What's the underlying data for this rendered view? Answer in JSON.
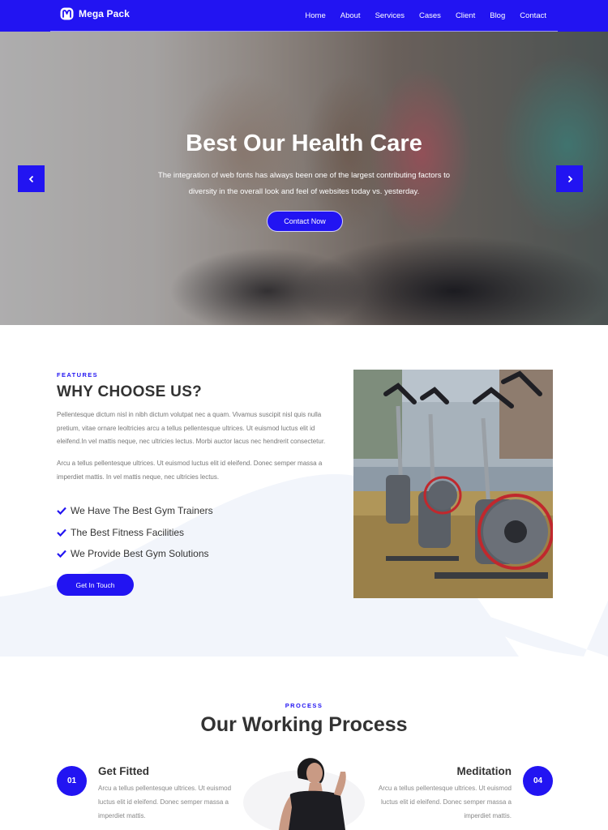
{
  "nav": {
    "brand": "Mega Pack",
    "items": [
      "Home",
      "About",
      "Services",
      "Cases",
      "Client",
      "Blog",
      "Contact"
    ]
  },
  "hero": {
    "title": "Best Our Health Care",
    "text": "The integration of web fonts has always been one of the largest contributing factors to diversity in the overall look and feel of websites today vs. yesterday.",
    "button": "Contact Now"
  },
  "features": {
    "eyebrow": "FEATURES",
    "title": "WHY CHOOSE US?",
    "paragraph1": "Pellentesque dictum nisl in nibh dictum volutpat nec a quam. Vivamus suscipit nisl quis nulla pretium, vitae ornare leoltricies arcu a tellus pellentesque ultrices. Ut euismod luctus elit id eleifend.In vel mattis neque, nec ultricies lectus. Morbi auctor lacus nec hendrerit consectetur.",
    "paragraph2": "Arcu a tellus pellentesque ultrices. Ut euismod luctus elit id eleifend. Donec semper massa a imperdiet mattis. In vel mattis neque, nec ultricies lectus.",
    "checklist": [
      "We Have The Best Gym Trainers",
      "The Best Fitness Facilities",
      "We Provide Best Gym Solutions"
    ],
    "button": "Get In Touch"
  },
  "process": {
    "eyebrow": "PROCESS",
    "title": "Our Working Process",
    "steps": [
      {
        "num": "01",
        "title": "Get Fitted",
        "text": "Arcu a tellus pellentesque ultrices. Ut euismod luctus elit id eleifend. Donec semper massa a imperdiet mattis."
      },
      {
        "num": "04",
        "title": "Meditation",
        "text": "Arcu a tellus pellentesque ultrices. Ut euismod luctus elit id eleifend. Donec semper massa a imperdiet mattis."
      }
    ]
  },
  "colors": {
    "accent": "#2214f2",
    "light_bg": "#f2f5fb"
  },
  "icons": {
    "logo": "m-logo-icon",
    "prev": "chevron-left-icon",
    "next": "chevron-right-icon",
    "check": "check-icon"
  }
}
